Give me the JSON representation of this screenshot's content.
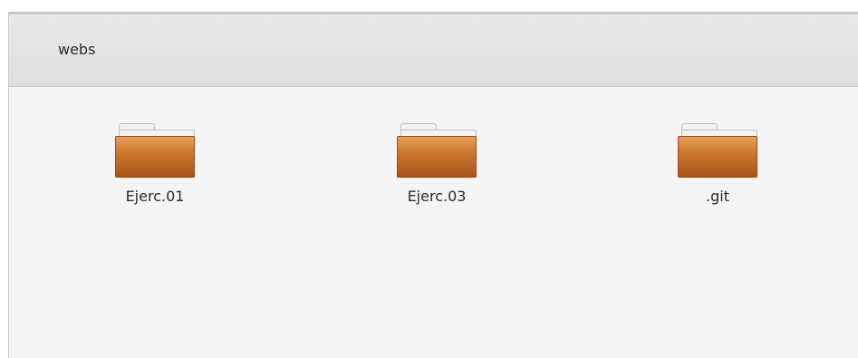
{
  "header": {
    "title": "webs"
  },
  "files": [
    {
      "name": "Ejerc.01",
      "type": "folder"
    },
    {
      "name": "Ejerc.03",
      "type": "folder"
    },
    {
      "name": ".git",
      "type": "folder"
    }
  ],
  "colors": {
    "folder_top": "#e8a360",
    "folder_mid": "#cf7c30",
    "folder_bottom": "#a8521b",
    "background": "#f5f5f5",
    "header": "#e5e5e5"
  },
  "icons": {
    "item_icon": "folder-icon"
  }
}
